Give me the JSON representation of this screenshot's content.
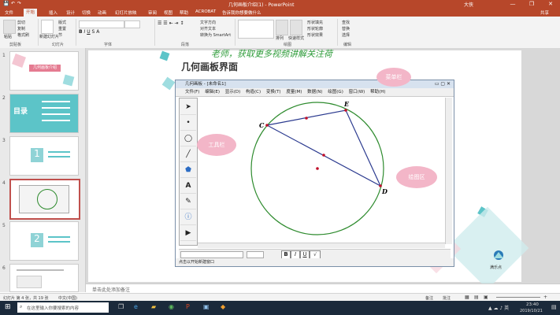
{
  "app": {
    "title": "几何画板介绍(1) - PowerPoint",
    "user": "大侠",
    "quick_access": [
      "save-icon",
      "undo-icon",
      "redo-icon"
    ],
    "window_controls": [
      "—",
      "❐",
      "✕"
    ]
  },
  "ribbon": {
    "tabs": [
      "文件",
      "开始",
      "插入",
      "设计",
      "切换",
      "动画",
      "幻灯片放映",
      "审阅",
      "视图",
      "帮助",
      "ACROBAT",
      "告诉我你想要做什么"
    ],
    "active_tab": "开始",
    "share": "共享",
    "groups": [
      "剪贴板",
      "幻灯片",
      "字体",
      "段落",
      "绘图",
      "编辑"
    ],
    "buttons": {
      "paste": "粘贴",
      "cut": "剪切",
      "copy": "复制",
      "format_painter": "格式刷",
      "new_slide": "新建幻灯片",
      "layout": "版式",
      "reset": "重置",
      "section": "节",
      "find": "查找",
      "replace": "替换",
      "select": "选择",
      "arrange": "排列",
      "quick_styles": "快速样式",
      "shape_fill": "形状填充",
      "shape_outline": "形状轮廓",
      "shape_effects": "形状效果",
      "text_direction": "文字方向",
      "align_text": "对齐文本",
      "smartart": "转换为 SmartArt"
    }
  },
  "thumbnails": [
    {
      "num": "1",
      "title": "几何画板介绍"
    },
    {
      "num": "2",
      "title": "目录"
    },
    {
      "num": "3",
      "title": ""
    },
    {
      "num": "4",
      "title": ""
    },
    {
      "num": "5",
      "title": ""
    },
    {
      "num": "6",
      "title": ""
    }
  ],
  "slide": {
    "watermark": "老师，获取更多视频讲解关注荷",
    "heading": "几何画板界面",
    "bubble_menu": "菜单栏",
    "bubble_tools": "工具栏",
    "bubble_canvas": "绘图区",
    "logo_text": "满乐点"
  },
  "gsp": {
    "title": "几何画板 - [未命名1]",
    "menu": [
      "文件(F)",
      "编辑(E)",
      "显示(D)",
      "构造(C)",
      "变换(T)",
      "度量(M)",
      "数据(N)",
      "绘图(G)",
      "窗口(W)",
      "帮助(H)"
    ],
    "points": [
      "C",
      "E",
      "D"
    ],
    "text_buttons": [
      "B",
      "I",
      "U"
    ],
    "status": "点击以开始新建窗口"
  },
  "notes": {
    "placeholder": "单击此处添加备注"
  },
  "status": {
    "slide_info": "幻灯片 第 4 张，共 19 张",
    "lang": "中文(中国)",
    "notes_btn": "备注",
    "comments_btn": "批注",
    "zoom": "+"
  },
  "taskbar": {
    "search_placeholder": "在这里输入你要搜索的内容",
    "time": "23:40",
    "date": "2019/10/21"
  },
  "colors": {
    "accent": "#b7472a",
    "bubble": "#f3b6c8",
    "teal": "#5cc4c8",
    "circle": "#2e8b2e",
    "triangle": "#2b3a8f",
    "point": "#c0102a"
  }
}
